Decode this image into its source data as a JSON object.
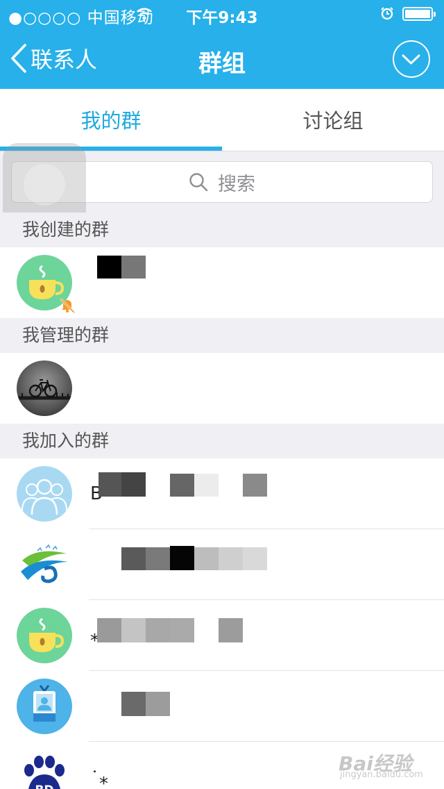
{
  "status_bar": {
    "carrier": "●○○○○ 中国移动",
    "time": "下午9:43"
  },
  "nav": {
    "back_label": "联系人",
    "title": "群组"
  },
  "tabs": [
    {
      "label": "我的群",
      "active": true
    },
    {
      "label": "讨论组",
      "active": false
    }
  ],
  "search": {
    "placeholder": "搜索"
  },
  "sections": {
    "created": "我创建的群",
    "managed": "我管理的群",
    "joined": "我加入的群"
  },
  "joined_groups": [
    {
      "name_visible": "B"
    },
    {
      "name_visible": ""
    },
    {
      "name_visible": "⁎"
    },
    {
      "name_visible": ""
    },
    {
      "name_visible": "˙⁎"
    }
  ],
  "avatars": {
    "created_0": "coffee-cup-icon",
    "managed_0": "bicycle-photo",
    "joined_0": "group-people-icon",
    "joined_1": "green-blue-wave-logo",
    "joined_2": "coffee-cup-icon",
    "joined_3": "id-badge-icon",
    "joined_4": "baidu-paw-logo"
  },
  "colors": {
    "accent": "#27b0ea",
    "tab_active": "#1ea9df",
    "section_bg": "#efeff4"
  },
  "watermark": {
    "brand": "Bai经验",
    "url": "jingyan.baidu.com"
  }
}
